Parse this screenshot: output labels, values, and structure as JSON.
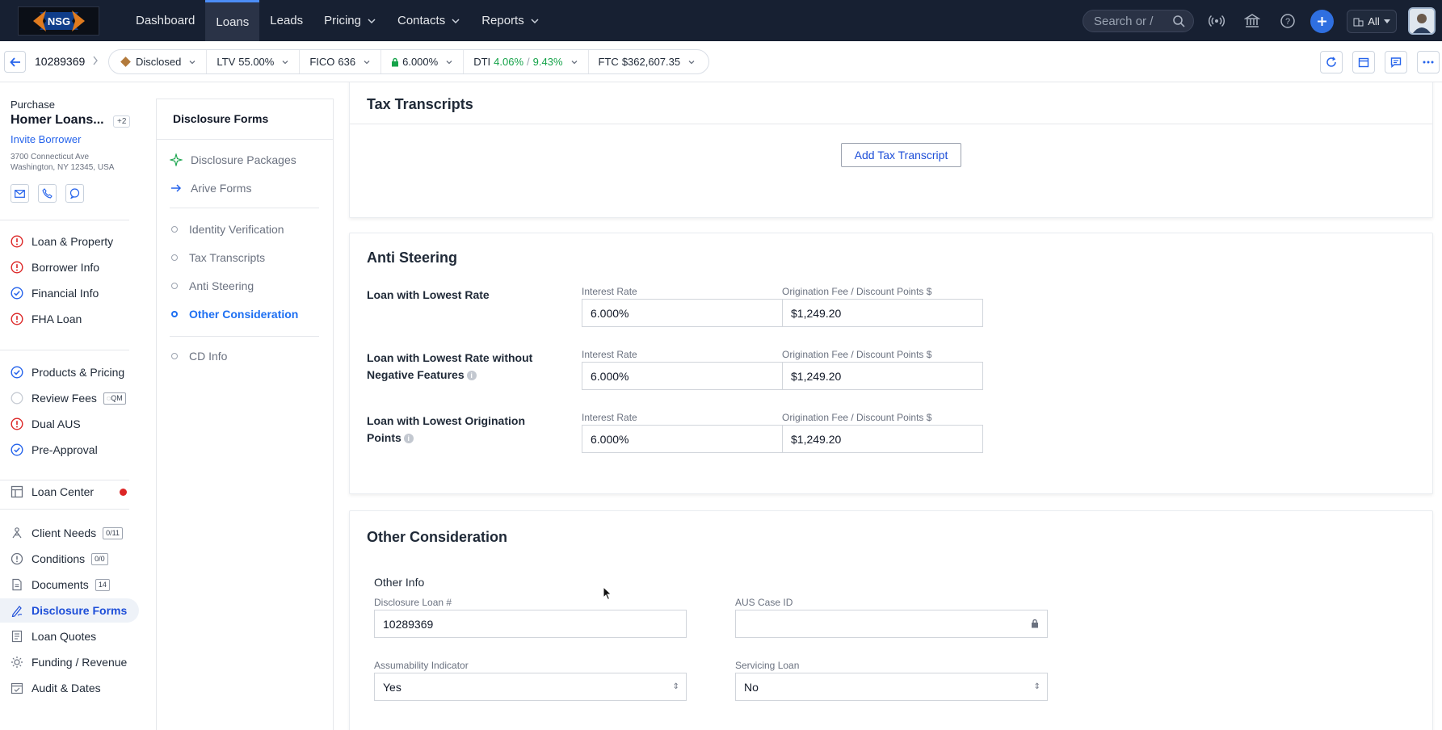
{
  "topnav": {
    "logo_text": "NSG",
    "items": [
      {
        "label": "Dashboard",
        "dropdown": false
      },
      {
        "label": "Loans",
        "dropdown": false,
        "active": true
      },
      {
        "label": "Leads",
        "dropdown": false
      },
      {
        "label": "Pricing",
        "dropdown": true
      },
      {
        "label": "Contacts",
        "dropdown": true
      },
      {
        "label": "Reports",
        "dropdown": true
      }
    ],
    "search_placeholder": "Search or /",
    "scope_label": "All",
    "icons": [
      "broadcast-icon",
      "bank-icon",
      "help-icon",
      "plus-icon"
    ]
  },
  "loanbar": {
    "loan_number": "10289369",
    "status": "Disclosed",
    "ltv_label": "LTV",
    "ltv_value": "55.00%",
    "fico_label": "FICO",
    "fico_value": "636",
    "rate_value": "6.000%",
    "dti_label": "DTI",
    "dti_front": "4.06%",
    "dti_sep": "/",
    "dti_back": "9.43%",
    "ftc_label": "FTC",
    "ftc_value": "$362,607.35"
  },
  "borrower": {
    "purpose": "Purchase",
    "name": "Homer Loans...",
    "extra_count": "+2",
    "invite_label": "Invite Borrower",
    "address_line1": "3700 Connecticut Ave",
    "address_line2": "Washington, NY 12345, USA"
  },
  "leftnav": {
    "group1": [
      {
        "label": "Loan & Property",
        "status": "error"
      },
      {
        "label": "Borrower Info",
        "status": "error"
      },
      {
        "label": "Financial Info",
        "status": "done"
      },
      {
        "label": "FHA Loan",
        "status": "error"
      }
    ],
    "group2": [
      {
        "label": "Products & Pricing",
        "status": "done"
      },
      {
        "label": "Review Fees",
        "status": "empty",
        "badge": "QM"
      },
      {
        "label": "Dual AUS",
        "status": "error"
      },
      {
        "label": "Pre-Approval",
        "status": "done"
      }
    ],
    "loan_center": "Loan Center",
    "group3": [
      {
        "label": "Client Needs",
        "badge": "0/11",
        "icon": "client-needs-icon"
      },
      {
        "label": "Conditions",
        "badge": "0/0",
        "icon": "conditions-icon"
      },
      {
        "label": "Documents",
        "badge": "14",
        "icon": "documents-icon"
      },
      {
        "label": "Disclosure Forms",
        "active": true,
        "icon": "disclosure-icon"
      },
      {
        "label": "Loan Quotes",
        "icon": "quotes-icon"
      },
      {
        "label": "Funding / Revenue",
        "icon": "funding-icon"
      },
      {
        "label": "Audit & Dates",
        "icon": "audit-icon"
      }
    ]
  },
  "midnav": {
    "title": "Disclosure Forms",
    "top_items": [
      "Disclosure Packages",
      "Arive Forms"
    ],
    "items": [
      "Identity Verification",
      "Tax Transcripts",
      "Anti Steering",
      "Other Consideration"
    ],
    "active": "Other Consideration",
    "bottom_items": [
      "CD Info"
    ]
  },
  "tax_transcripts": {
    "title": "Tax Transcripts",
    "add_button": "Add Tax Transcript"
  },
  "anti_steering": {
    "title": "Anti Steering",
    "rows": [
      {
        "label": "Loan with Lowest Rate",
        "info": false,
        "rate_label": "Interest Rate",
        "rate": "6.000%",
        "fee_label": "Origination Fee / Discount Points $",
        "fee": "$1,249.20"
      },
      {
        "label": "Loan with Lowest Rate without Negative Features",
        "info": true,
        "rate_label": "Interest Rate",
        "rate": "6.000%",
        "fee_label": "Origination Fee / Discount Points $",
        "fee": "$1,249.20"
      },
      {
        "label": "Loan with Lowest Origination Points",
        "info": true,
        "rate_label": "Interest Rate",
        "rate": "6.000%",
        "fee_label": "Origination Fee / Discount Points $",
        "fee": "$1,249.20"
      }
    ]
  },
  "other_consideration": {
    "title": "Other Consideration",
    "subhead": "Other Info",
    "disclosure_loan_label": "Disclosure Loan #",
    "disclosure_loan_value": "10289369",
    "aus_case_label": "AUS Case ID",
    "aus_case_value": "",
    "assumability_label": "Assumability Indicator",
    "assumability_value": "Yes",
    "servicing_label": "Servicing Loan",
    "servicing_value": "No"
  }
}
